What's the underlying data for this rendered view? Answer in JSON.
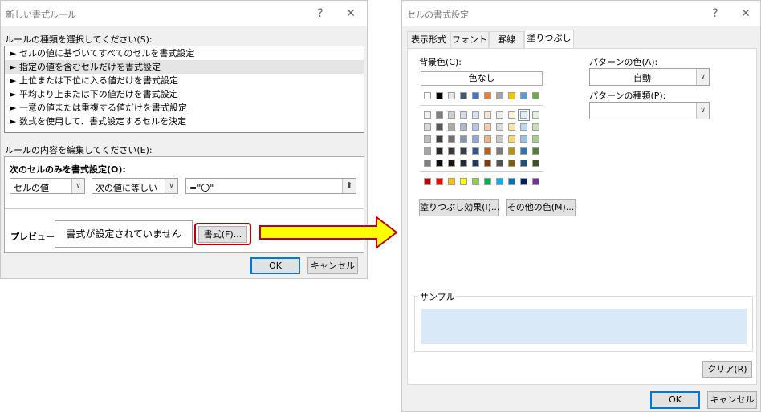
{
  "left_dialog": {
    "title": "新しい書式ルール",
    "help_glyph": "?",
    "close_glyph": "✕",
    "rule_type_label": "ルールの種類を選択してください(S):",
    "rule_types": [
      "► セルの値に基づいてすべてのセルを書式設定",
      "► 指定の値を含むセルだけを書式設定",
      "► 上位または下位に入る値だけを書式設定",
      "► 平均より上または下の値だけを書式設定",
      "► 一意の値または重複する値だけを書式設定",
      "► 数式を使用して、書式設定するセルを決定"
    ],
    "selected_rule_index": 1,
    "edit_label": "ルールの内容を編集してください(E):",
    "format_only_label": "次のセルのみを書式設定(O):",
    "condition_field": "セルの値",
    "operator": "次の値に等しい",
    "value": "=\"〇\"",
    "preview_label": "プレビュー:",
    "preview_text": "書式が設定されていません",
    "format_button": "書式(F)...",
    "ok_button": "OK",
    "cancel_button": "キャンセル"
  },
  "arrow_color": "#ffff00",
  "highlight_color": "#c00000",
  "right_dialog": {
    "title": "セルの書式設定",
    "help_glyph": "?",
    "close_glyph": "✕",
    "tabs": [
      "表示形式",
      "フォント",
      "罫線",
      "塗りつぶし"
    ],
    "active_tab_index": 3,
    "bg_color_label": "背景色(C):",
    "no_color_button": "色なし",
    "pattern_color_label": "パターンの色(A):",
    "pattern_color_value": "自動",
    "pattern_style_label": "パターンの種類(P):",
    "pattern_style_value": "",
    "fill_effects_button": "塗りつぶし効果(I)...",
    "more_colors_button": "その他の色(M)...",
    "sample_label": "サンプル",
    "clear_button": "クリア(R)",
    "ok_button": "OK",
    "cancel_button": "キャンセル",
    "sample_color": "#dae9f8",
    "theme_top_row": [
      "#ffffff",
      "#000000",
      "#e7e6e6",
      "#44546a",
      "#4472c4",
      "#ed7d31",
      "#a5a5a5",
      "#ffc000",
      "#5b9bd5",
      "#70ad47"
    ],
    "theme_tints": [
      [
        "#f2f2f2",
        "#7f7f7f",
        "#d0cece",
        "#d6dce4",
        "#d9e2f3",
        "#fbe5d5",
        "#ededed",
        "#fff2cc",
        "#deebf6",
        "#e2efd9"
      ],
      [
        "#d8d8d8",
        "#595959",
        "#aeabab",
        "#adb9ca",
        "#b4c6e7",
        "#f7cbac",
        "#dbdbdb",
        "#fee599",
        "#bdd7ee",
        "#c5e0b3"
      ],
      [
        "#bfbfbf",
        "#3f3f3f",
        "#757070",
        "#8496b0",
        "#8eaadb",
        "#f4b183",
        "#c9c9c9",
        "#ffd965",
        "#9cc3e5",
        "#a8d08d"
      ],
      [
        "#a5a5a5",
        "#262626",
        "#3a3838",
        "#333f4f",
        "#2f5496",
        "#c55a11",
        "#7b7b7b",
        "#bf9000",
        "#2e75b5",
        "#538135"
      ],
      [
        "#7f7f7f",
        "#0c0c0c",
        "#171616",
        "#222a35",
        "#1f3864",
        "#833c0b",
        "#525252",
        "#7f6000",
        "#1e4e79",
        "#375623"
      ]
    ],
    "standard_colors": [
      "#c00000",
      "#ff0000",
      "#ffc000",
      "#ffff00",
      "#92d050",
      "#00b050",
      "#00b0f0",
      "#0070c0",
      "#002060",
      "#7030a0"
    ]
  }
}
